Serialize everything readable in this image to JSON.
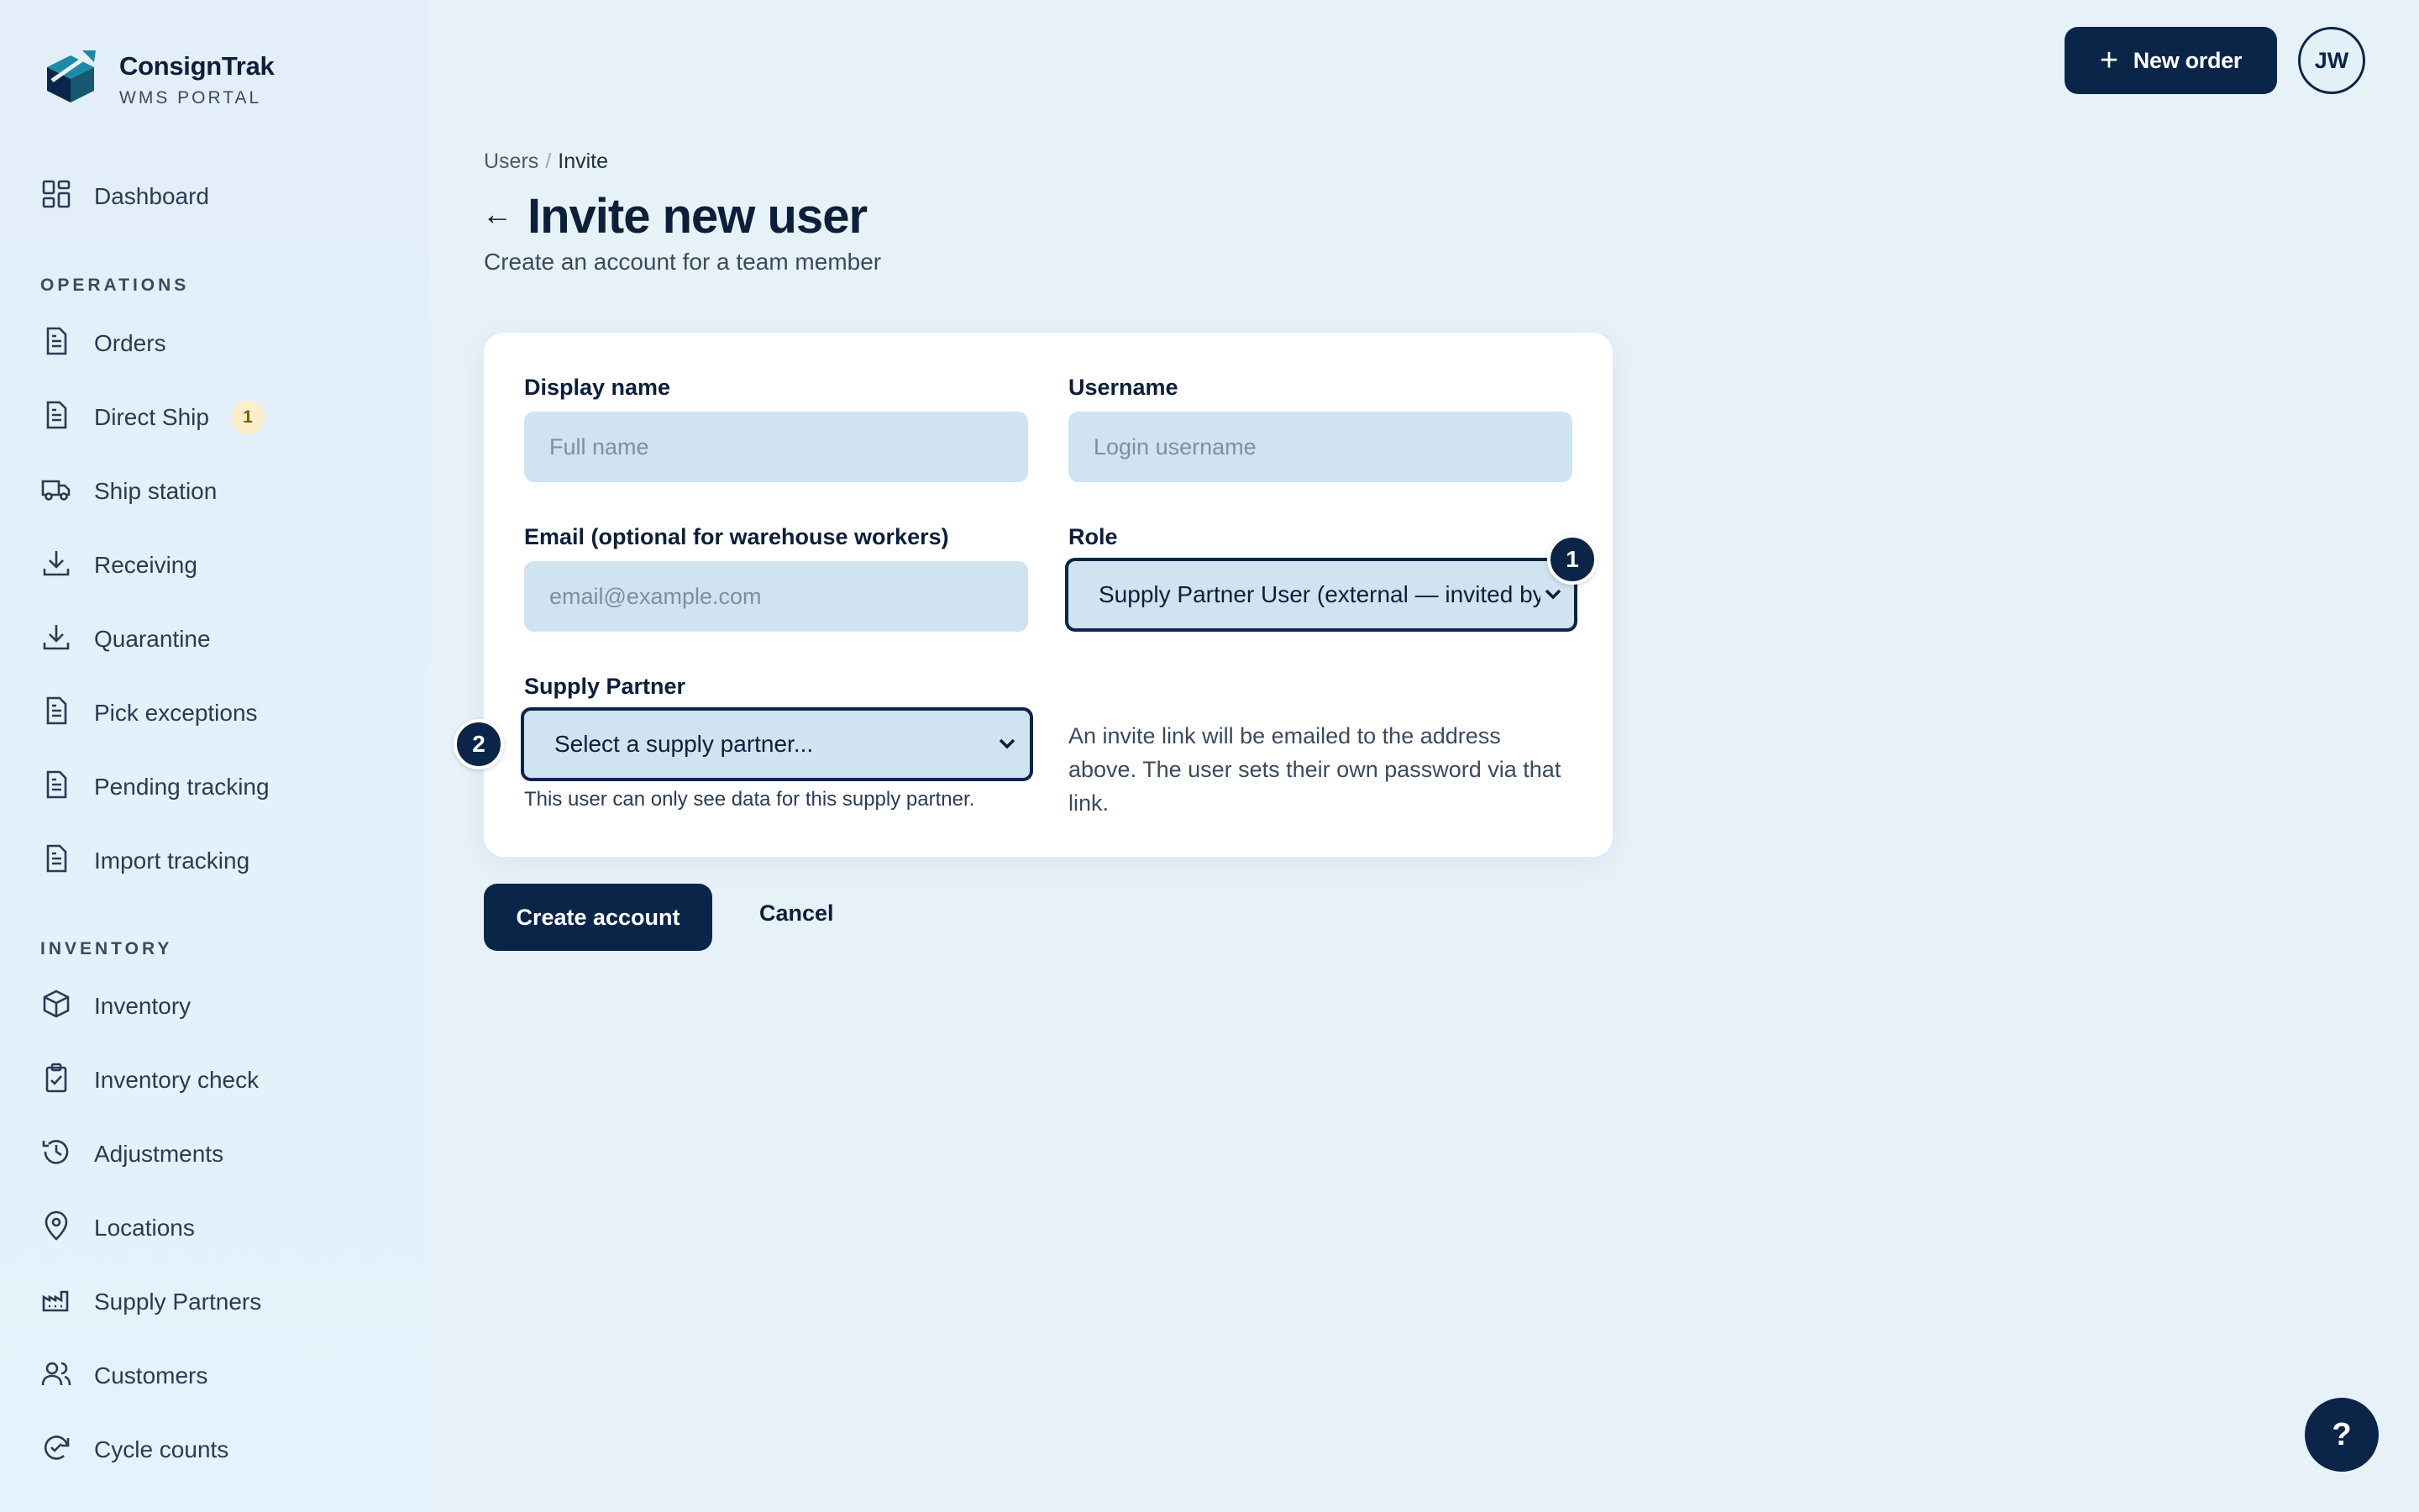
{
  "brand": {
    "name": "ConsignTrak",
    "subtitle": "WMS PORTAL"
  },
  "sidebar": {
    "dashboard": "Dashboard",
    "sections": {
      "operations": "OPERATIONS",
      "inventory": "INVENTORY"
    },
    "operations_items": [
      {
        "label": "Orders",
        "icon": "document-icon"
      },
      {
        "label": "Direct Ship",
        "icon": "document-icon",
        "badge": "1"
      },
      {
        "label": "Ship station",
        "icon": "truck-icon"
      },
      {
        "label": "Receiving",
        "icon": "download-icon"
      },
      {
        "label": "Quarantine",
        "icon": "download-icon"
      },
      {
        "label": "Pick exceptions",
        "icon": "document-icon"
      },
      {
        "label": "Pending tracking",
        "icon": "document-icon"
      },
      {
        "label": "Import tracking",
        "icon": "document-icon"
      }
    ],
    "inventory_items": [
      {
        "label": "Inventory",
        "icon": "box-icon"
      },
      {
        "label": "Inventory check",
        "icon": "clipboard-check-icon"
      },
      {
        "label": "Adjustments",
        "icon": "history-icon"
      },
      {
        "label": "Locations",
        "icon": "map-pin-icon"
      },
      {
        "label": "Supply Partners",
        "icon": "factory-icon"
      },
      {
        "label": "Customers",
        "icon": "users-icon"
      },
      {
        "label": "Cycle counts",
        "icon": "refresh-check-icon"
      }
    ]
  },
  "header": {
    "new_order_label": "New order",
    "avatar_initials": "JW"
  },
  "breadcrumb": {
    "parent": "Users",
    "separator": "/",
    "current": "Invite"
  },
  "page": {
    "back": "←",
    "title": "Invite new user",
    "subtitle": "Create an account for a team member"
  },
  "form": {
    "display_name": {
      "label": "Display name",
      "placeholder": "Full name",
      "value": ""
    },
    "username": {
      "label": "Username",
      "placeholder": "Login username",
      "value": ""
    },
    "email": {
      "label": "Email (optional for warehouse workers)",
      "placeholder": "email@example.com",
      "value": ""
    },
    "role": {
      "label": "Role",
      "selected": "Supply Partner User (external — invited by"
    },
    "supply_partner": {
      "label": "Supply Partner",
      "selected": "Select a supply partner...",
      "helper": "This user can only see data for this supply partner."
    },
    "info_text": "An invite link will be emailed to the address above. The user sets their own password via that link.",
    "markers": [
      "1",
      "2"
    ]
  },
  "actions": {
    "create": "Create account",
    "cancel": "Cancel"
  },
  "help_label": "?",
  "colors": {
    "primary": "#0b2548",
    "input_bg": "#cfe3f0",
    "page_bg": "#e7f1f8",
    "badge_bg": "#fcefc7"
  }
}
